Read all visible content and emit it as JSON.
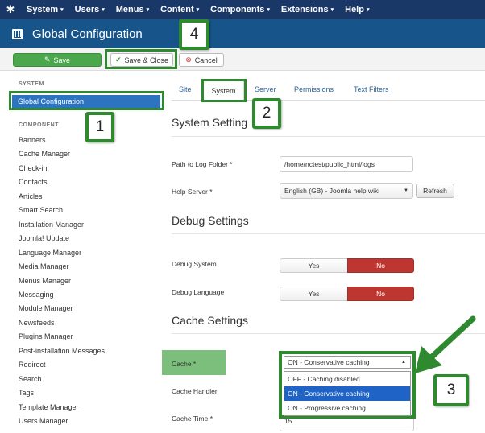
{
  "navbar": {
    "logo_icon": "joomla-logo-icon",
    "items": [
      {
        "label": "System"
      },
      {
        "label": "Users"
      },
      {
        "label": "Menus"
      },
      {
        "label": "Content"
      },
      {
        "label": "Components"
      },
      {
        "label": "Extensions"
      },
      {
        "label": "Help"
      }
    ],
    "caret": "▾"
  },
  "header": {
    "title": "Global Configuration",
    "icon": "equalizer-icon"
  },
  "toolbar": {
    "save_label": "Save",
    "save_icon": "✎",
    "save_close_label": "Save & Close",
    "save_close_icon": "✔",
    "cancel_label": "Cancel",
    "cancel_icon": "⊗"
  },
  "sidebar": {
    "system_heading": "SYSTEM",
    "global_config": "Global Configuration",
    "component_heading": "COMPONENT",
    "items": [
      "Banners",
      "Cache Manager",
      "Check-in",
      "Contacts",
      "Articles",
      "Smart Search",
      "Installation Manager",
      "Joomla! Update",
      "Language Manager",
      "Media Manager",
      "Menus Manager",
      "Messaging",
      "Module Manager",
      "Newsfeeds",
      "Plugins Manager",
      "Post-installation Messages",
      "Redirect",
      "Search",
      "Tags",
      "Template Manager",
      "Users Manager"
    ]
  },
  "tabs": {
    "site": "Site",
    "system": "System",
    "server": "Server",
    "permissions": "Permissions",
    "text_filters": "Text Filters"
  },
  "system_settings": {
    "title": "System Setting",
    "log_path_label": "Path to Log Folder *",
    "log_path_value": "/home/nctest/public_html/logs",
    "help_server_label": "Help Server *",
    "help_server_value": "English (GB) - Joomla help wiki",
    "refresh_label": "Refresh"
  },
  "debug_settings": {
    "title": "Debug Settings",
    "debug_system_label": "Debug System",
    "debug_language_label": "Debug Language",
    "yes": "Yes",
    "no": "No"
  },
  "cache_settings": {
    "title": "Cache Settings",
    "cache_label": "Cache *",
    "cache_selected": "ON - Conservative caching",
    "cache_options": [
      "OFF - Caching disabled",
      "ON - Conservative caching",
      "ON - Progressive caching"
    ],
    "cache_handler_label": "Cache Handler",
    "cache_time_label": "Cache Time *",
    "cache_time_value": "15"
  },
  "callouts": {
    "one": "1",
    "two": "2",
    "three": "3",
    "four": "4"
  },
  "colors": {
    "navbar": "#1a3867",
    "header": "#17548a",
    "save_green": "#4ba74b",
    "no_red": "#bd362f",
    "selection_blue": "#1e63c5",
    "callout_green": "#2f8a2f"
  }
}
